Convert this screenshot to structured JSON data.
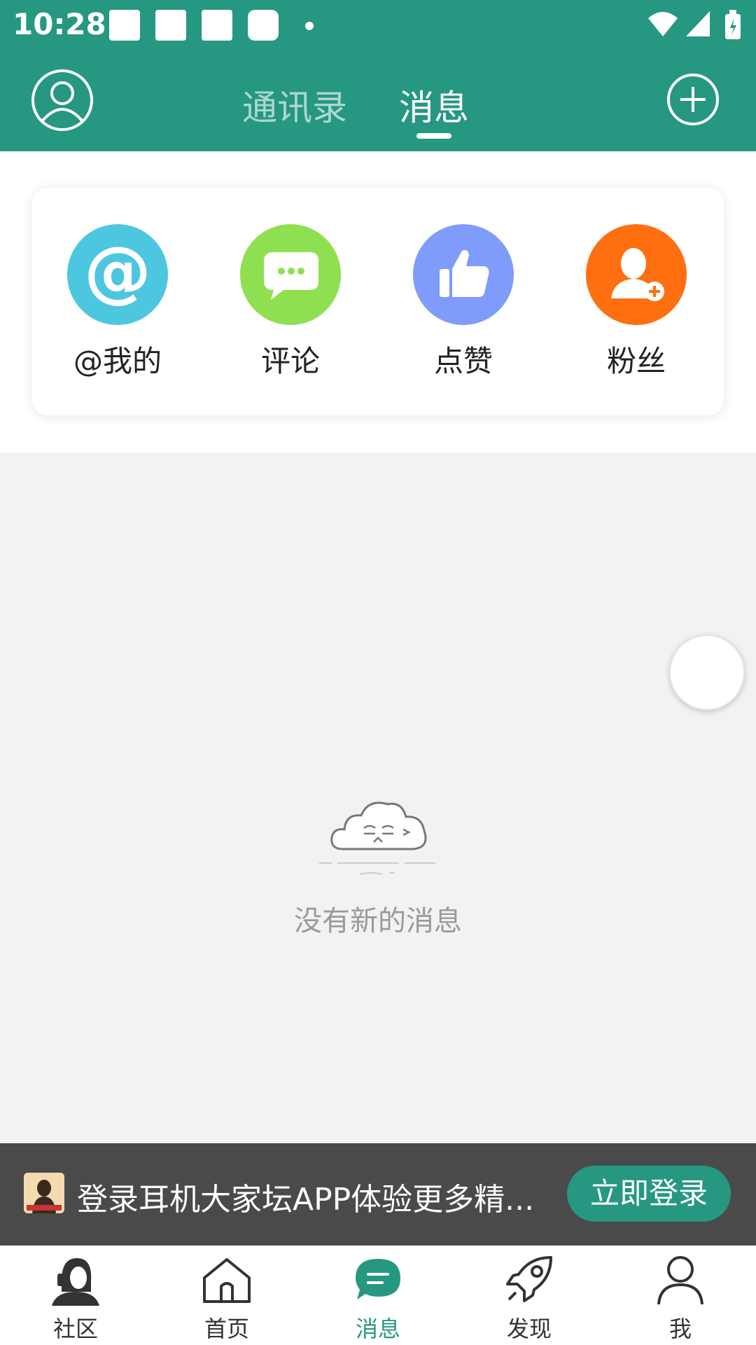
{
  "status_bar": {
    "time": "10:28"
  },
  "header": {
    "tabs": [
      {
        "label": "通讯录",
        "active": false
      },
      {
        "label": "消息",
        "active": true
      }
    ],
    "accent_color": "#269780"
  },
  "quick_actions": [
    {
      "label": "@我的",
      "icon": "at-icon",
      "color": "#4dc6e0"
    },
    {
      "label": "评论",
      "icon": "comment-icon",
      "color": "#8ee050"
    },
    {
      "label": "点赞",
      "icon": "thumbs-up-icon",
      "color": "#7f9cfb"
    },
    {
      "label": "粉丝",
      "icon": "add-fan-icon",
      "color": "#ff6f10"
    }
  ],
  "empty_state": {
    "message": "没有新的消息"
  },
  "login_banner": {
    "text": "登录耳机大家坛APP体验更多精...",
    "button_label": "立即登录"
  },
  "bottom_nav": [
    {
      "label": "社区",
      "icon": "community-avatar-icon",
      "active": false
    },
    {
      "label": "首页",
      "icon": "home-icon",
      "active": false
    },
    {
      "label": "消息",
      "icon": "message-bubble-icon",
      "active": true
    },
    {
      "label": "发现",
      "icon": "rocket-icon",
      "active": false
    },
    {
      "label": "我",
      "icon": "person-icon",
      "active": false
    }
  ]
}
